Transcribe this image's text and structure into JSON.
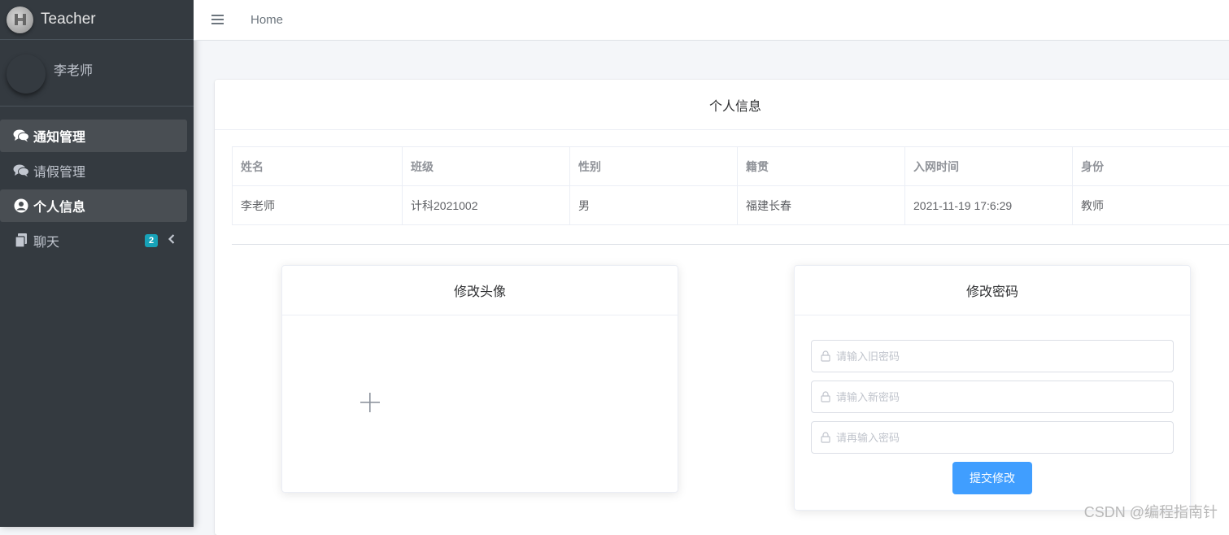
{
  "brand": {
    "title": "Teacher"
  },
  "user": {
    "name": "李老师"
  },
  "sidebar": {
    "items": [
      {
        "label": "通知管理",
        "icon": "comments-icon"
      },
      {
        "label": "请假管理",
        "icon": "comments-icon"
      },
      {
        "label": "个人信息",
        "icon": "user-circle-icon"
      },
      {
        "label": "聊天",
        "icon": "copy-icon",
        "badge": "2"
      }
    ]
  },
  "header": {
    "home": "Home"
  },
  "profile": {
    "title": "个人信息",
    "columns": [
      "姓名",
      "班级",
      "性别",
      "籍贯",
      "入网时间",
      "身份"
    ],
    "row": [
      "李老师",
      "计科2021002",
      "男",
      "福建长春",
      "2021-11-19 17:6:29",
      "教师"
    ]
  },
  "avatar_card": {
    "title": "修改头像"
  },
  "password_card": {
    "title": "修改密码",
    "old_placeholder": "请输入旧密码",
    "new_placeholder": "请输入新密码",
    "confirm_placeholder": "请再输入密码",
    "submit": "提交修改"
  },
  "watermark": "CSDN @编程指南针",
  "colors": {
    "sidebar_bg": "#343a40",
    "active_item_bg": "#494e53",
    "badge": "#17a2b8",
    "primary_button": "#409eff"
  }
}
